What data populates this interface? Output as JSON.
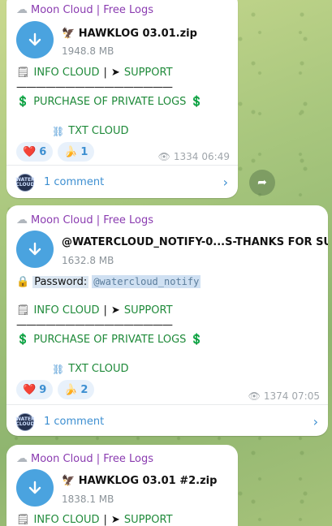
{
  "channel_name": "Moon Cloud | Free Logs",
  "posts": [
    {
      "file_name": "HAWKLOG 03.01.zip",
      "file_size": "1948.8 MB",
      "info_label": "INFO CLOUD",
      "support_label": "SUPPORT",
      "dashes": "————————————————",
      "purchase_label": "PURCHASE OF PRIVATE LOGS",
      "txt_label": "TXT CLOUD",
      "reactions": [
        {
          "emoji": "❤️",
          "count": "6"
        },
        {
          "emoji": "🍌",
          "count": "1"
        }
      ],
      "views": "1334",
      "time": "06:49",
      "comments_label": "1 comment"
    },
    {
      "file_name": "@WATERCLOUD_NOTIFY-0...S-THANKS FOR SUB.rar",
      "file_size": "1632.8 MB",
      "password_label": "Password:",
      "password_value": "@watercloud_notify",
      "info_label": "INFO CLOUD",
      "support_label": "SUPPORT",
      "dashes": "————————————————",
      "purchase_label": "PURCHASE OF PRIVATE LOGS",
      "txt_label": "TXT CLOUD",
      "reactions": [
        {
          "emoji": "❤️",
          "count": "9"
        },
        {
          "emoji": "🍌",
          "count": "2"
        }
      ],
      "views": "1374",
      "time": "07:05",
      "comments_label": "1 comment"
    },
    {
      "file_name": "HAWKLOG 03.01 #2.zip",
      "file_size": "1838.1 MB",
      "info_label": "INFO CLOUD",
      "support_label": "SUPPORT"
    }
  ],
  "avatar_text": "WATER CLOUD",
  "colors": {
    "channel": "#8a3bb0",
    "link_green": "#1f8a3a",
    "accent_blue": "#3d8fd1",
    "file_button": "#4aa3df"
  },
  "icons": {
    "cloud": "cloud-icon",
    "download": "download-arrow-icon",
    "doc": "document-icon",
    "send": "paper-plane-icon",
    "money": "money-bag-icon",
    "share": "share-icon",
    "eye": "eye-icon",
    "lock": "lock-icon"
  }
}
